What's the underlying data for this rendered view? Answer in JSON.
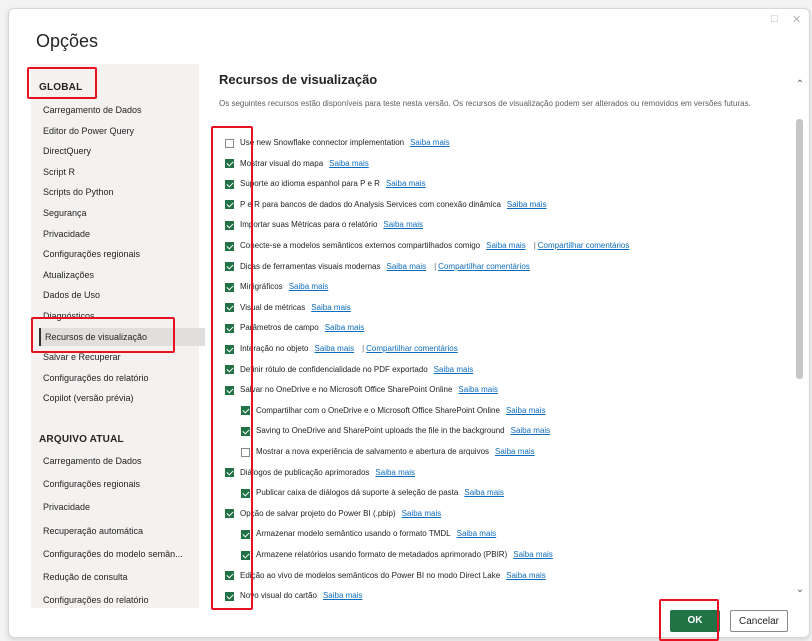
{
  "window": {
    "title": "Opções",
    "maximize_glyph": "□",
    "close_glyph": "✕"
  },
  "sidebar": {
    "global_heading": "GLOBAL",
    "global_items": [
      "Carregamento de Dados",
      "Editor do Power Query",
      "DirectQuery",
      "Script R",
      "Scripts do Python",
      "Segurança",
      "Privacidade",
      "Configurações regionais",
      "Atualizações",
      "Dados de Uso",
      "Diagnósticos",
      "Recursos de visualização",
      "Salvar e Recuperar",
      "Configurações do relatório",
      "Copilot (versão prévia)"
    ],
    "selected": "Recursos de visualização",
    "current_heading": "ARQUIVO ATUAL",
    "current_items": [
      "Carregamento de Dados",
      "Configurações regionais",
      "Privacidade",
      "Recuperação automática",
      "Configurações do modelo semân...",
      "Redução de consulta",
      "Configurações do relatório"
    ]
  },
  "content": {
    "title": "Recursos de visualização",
    "description": "Os seguintes recursos estão disponíveis para teste nesta versão. Os recursos de visualização podem ser alterados ou removidos em versões futuras.",
    "learn_more": "Saiba mais",
    "share_feedback": "Compartilhar comentários",
    "features": [
      {
        "label": "Use new Snowflake connector implementation",
        "checked": false,
        "indent": 0,
        "feedback": false
      },
      {
        "label": "Mostrar visual do mapa",
        "checked": true,
        "indent": 0,
        "feedback": false
      },
      {
        "label": "Suporte ao idioma espanhol para P e R",
        "checked": true,
        "indent": 0,
        "feedback": false
      },
      {
        "label": "P e R para bancos de dados do Analysis Services com conexão dinâmica",
        "checked": true,
        "indent": 0,
        "feedback": false
      },
      {
        "label": "Importar suas Métricas para o relatório",
        "checked": true,
        "indent": 0,
        "feedback": false
      },
      {
        "label": "Conecte-se a modelos semânticos externos compartilhados comigo",
        "checked": true,
        "indent": 0,
        "feedback": true
      },
      {
        "label": "Dicas de ferramentas visuais modernas",
        "checked": true,
        "indent": 0,
        "feedback": true
      },
      {
        "label": "Minigráficos",
        "checked": true,
        "indent": 0,
        "feedback": false
      },
      {
        "label": "Visual de métricas",
        "checked": true,
        "indent": 0,
        "feedback": false
      },
      {
        "label": "Parâmetros de campo",
        "checked": true,
        "indent": 0,
        "feedback": false
      },
      {
        "label": "Interação no objeto",
        "checked": true,
        "indent": 0,
        "feedback": true
      },
      {
        "label": "Definir rótulo de confidencialidade no PDF exportado",
        "checked": true,
        "indent": 0,
        "feedback": false
      },
      {
        "label": "Salvar no OneDrive e no Microsoft Office SharePoint Online",
        "checked": true,
        "indent": 0,
        "feedback": false
      },
      {
        "label": "Compartilhar com o OneDrive e o Microsoft Office SharePoint Online",
        "checked": true,
        "indent": 1,
        "feedback": false
      },
      {
        "label": "Saving to OneDrive and SharePoint uploads the file in the background",
        "checked": true,
        "indent": 1,
        "feedback": false
      },
      {
        "label": "Mostrar a nova experiência de salvamento e abertura de arquivos",
        "checked": false,
        "indent": 1,
        "feedback": false
      },
      {
        "label": "Diálogos de publicação aprimorados",
        "checked": true,
        "indent": 0,
        "feedback": false
      },
      {
        "label": "Publicar caixa de diálogos dá suporte à seleção de pasta",
        "checked": true,
        "indent": 1,
        "feedback": false
      },
      {
        "label": "Opção de salvar projeto do Power BI (.pbip)",
        "checked": true,
        "indent": 0,
        "feedback": false
      },
      {
        "label": "Armazenar modelo semântico usando o formato TMDL",
        "checked": true,
        "indent": 1,
        "feedback": false
      },
      {
        "label": "Armazene relatórios usando formato de metadados aprimorado (PBIR)",
        "checked": true,
        "indent": 1,
        "feedback": false
      },
      {
        "label": "Edição ao vivo de modelos semânticos do Power BI no modo Direct Lake",
        "checked": true,
        "indent": 0,
        "feedback": false
      },
      {
        "label": "Novo visual do cartão",
        "checked": true,
        "indent": 0,
        "feedback": false
      }
    ]
  },
  "scroll": {
    "up": "⌃",
    "down": "⌄"
  },
  "buttons": {
    "ok": "OK",
    "cancel": "Cancelar"
  },
  "colors": {
    "accent": "#217346",
    "link": "#0f6cbd",
    "highlight": "#e81123"
  }
}
